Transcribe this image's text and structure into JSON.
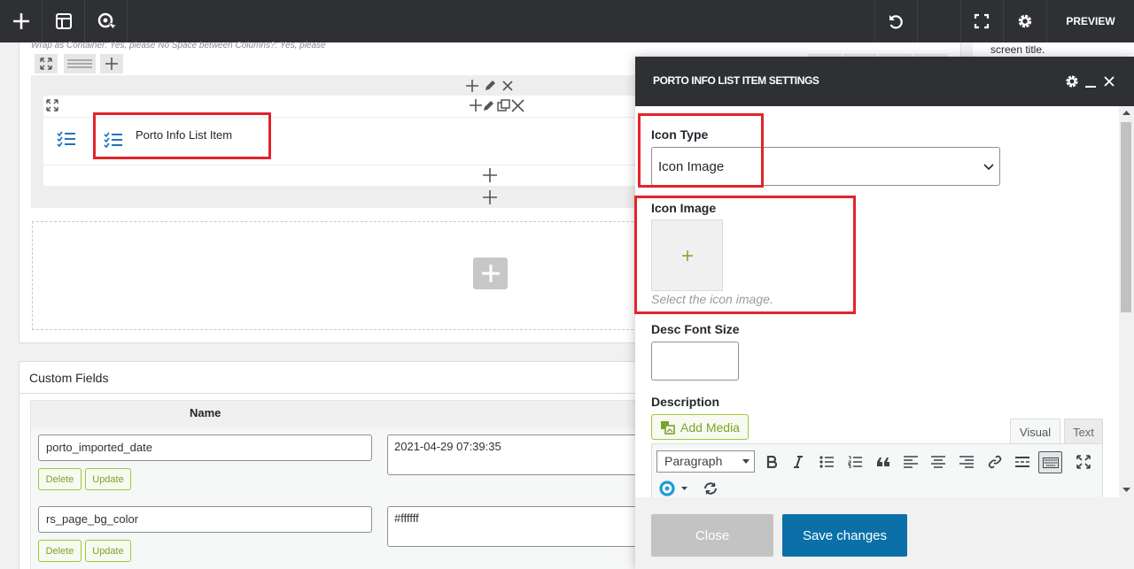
{
  "topbar": {
    "preview_label": "PREVIEW",
    "icons": [
      "plus-icon",
      "layout-icon",
      "search-cursor-icon",
      "undo-icon",
      "fullscreen-icon",
      "gear-icon"
    ]
  },
  "sidebar_right": {
    "screen_title": "screen title."
  },
  "builder": {
    "wrap_info": "Wrap as Container: Yes, please  No Space between Columns?: Yes, please",
    "item_label": "Porto Info List Item"
  },
  "custom_fields": {
    "title": "Custom Fields",
    "name_header": "Name",
    "rows": [
      {
        "key": "porto_imported_date",
        "value": "2021-04-29 07:39:35",
        "delete": "Delete",
        "update": "Update"
      },
      {
        "key": "rs_page_bg_color",
        "value": "#ffffff",
        "delete": "Delete",
        "update": "Update"
      }
    ]
  },
  "modal": {
    "title": "PORTO INFO LIST ITEM SETTINGS",
    "icon_type_label": "Icon Type",
    "icon_type_value": "Icon Image",
    "icon_image_label": "Icon Image",
    "icon_image_hint": "Select the icon image.",
    "desc_font_size_label": "Desc Font Size",
    "description_label": "Description",
    "add_media_label": "Add Media",
    "tab_visual": "Visual",
    "tab_text": "Text",
    "paragraph_select": "Paragraph",
    "close_label": "Close",
    "save_label": "Save changes"
  },
  "colors": {
    "accent": "#0c70a8",
    "highlight": "#e3232c",
    "green": "#7ba328",
    "dark": "#2e3033"
  }
}
